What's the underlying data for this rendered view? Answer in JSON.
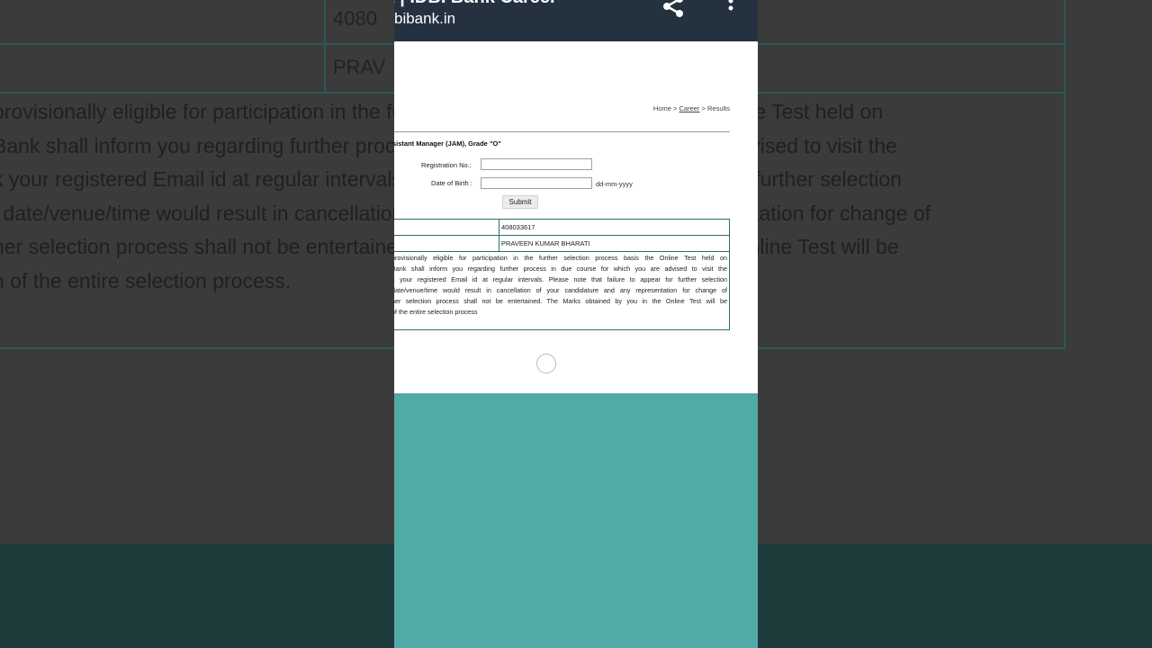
{
  "browser": {
    "title": "t | IDBI Bank Career",
    "url": "bibank.in"
  },
  "icons": {
    "share": "share-icon",
    "menu": "more-vert-icon"
  },
  "breadcrumb": {
    "home": "Home",
    "sep1": " > ",
    "career": "Career",
    "sep2": " > ",
    "results": "Results"
  },
  "heading": "sistant Manager (JAM), Grade \"O\"",
  "form": {
    "registration_label": "Registration No.:",
    "registration_value": "",
    "dob_label": "Date of Birth :",
    "dob_value": "",
    "dob_hint": "dd-mm-yyyy",
    "submit_label": "Submit"
  },
  "result": {
    "registration_no": "408033617",
    "name": "PRAVEEN KUMAR BHARATI",
    "message_lines": [
      " provisionally eligible for participation in the further selection process basis the Online Test held on",
      "Bank shall inform you regarding further process in due course for which you are advised to visit the",
      "k your registered Email id at regular intervals. Please note that failure to appear for further selection",
      "date/venue/time would result in cancellation of your candidature and any representation for change of",
      "ner selection process shall not be entertained. The Marks obtained by you in the Online Test will be",
      "of the entire selection process"
    ]
  },
  "background": {
    "reg_fragment": "4080",
    "name_fragment": "PRAV",
    "lines": [
      " provisionally eligible for participation in the further selection process basis the Online Test held on",
      " Bank shall inform you regarding further process in due course for which you are advised to visit the",
      "k your registered Email id at regular intervals. Please note that failure to appear for further selection",
      "l date/venue/time would result in cancellation of your candidature and any representation for change of",
      "her selection process shall not be entertained. The Marks obtained by you in the Online Test will be",
      "n of the entire selection process."
    ]
  },
  "colors": {
    "toolbar": "#243240",
    "teal": "#52aaa6",
    "table_border": "#2b6f69"
  }
}
